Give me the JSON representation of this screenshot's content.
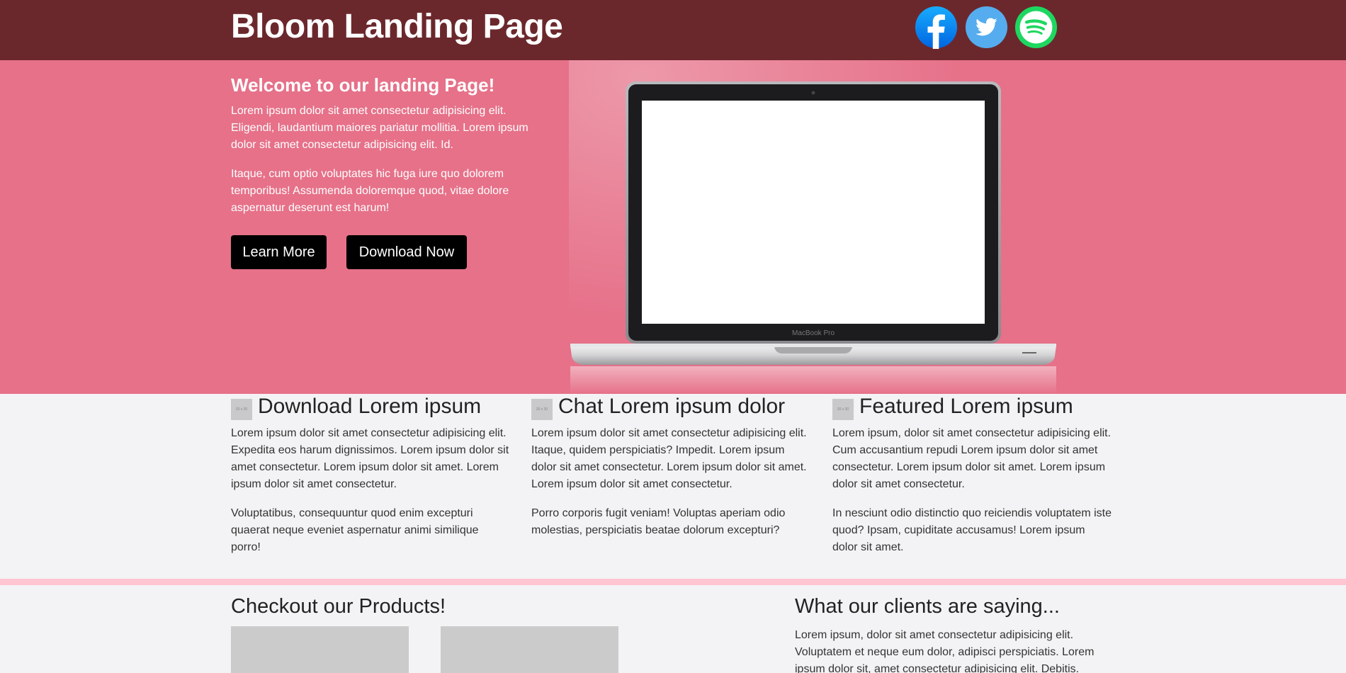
{
  "header": {
    "title": "Bloom Landing Page",
    "social": [
      {
        "icon": "facebook-icon",
        "color": "#1877f2"
      },
      {
        "icon": "twitter-icon",
        "color": "#55acee"
      },
      {
        "icon": "spotify-icon",
        "color": "#1ed760"
      }
    ]
  },
  "hero": {
    "title": "Welcome to our landing Page!",
    "paragraphs": [
      "Lorem ipsum dolor sit amet consectetur adipisicing elit. Eligendi, laudantium maiores pariatur mollitia. Lorem ipsum dolor sit amet consectetur adipisicing elit. Id.",
      "Itaque, cum optio voluptates hic fuga iure quo dolorem temporibus! Assumenda doloremque quod, vitae dolore aspernatur deserunt est harum!"
    ],
    "learn_more_label": "Learn More",
    "download_label": "Download Now",
    "laptop_brand": "MacBook Pro"
  },
  "features": [
    {
      "icon_text": "30 x 30",
      "title": "Download Lorem ipsum",
      "paragraphs": [
        "Lorem ipsum dolor sit amet consectetur adipisicing elit. Expedita eos harum dignissimos. Lorem ipsum dolor sit amet consectetur. Lorem ipsum dolor sit amet. Lorem ipsum dolor sit amet consectetur.",
        "Voluptatibus, consequuntur quod enim excepturi quaerat neque eveniet aspernatur animi similique porro!"
      ]
    },
    {
      "icon_text": "30 x 30",
      "title": "Chat Lorem ipsum dolor",
      "paragraphs": [
        "Lorem ipsum dolor sit amet consectetur adipisicing elit. Itaque, quidem perspiciatis? Impedit. Lorem ipsum dolor sit amet consectetur. Lorem ipsum dolor sit amet. Lorem ipsum dolor sit amet consectetur.",
        "Porro corporis fugit veniam! Voluptas aperiam odio molestias, perspiciatis beatae dolorum excepturi?"
      ]
    },
    {
      "icon_text": "30 x 30",
      "title": "Featured Lorem ipsum",
      "paragraphs": [
        "Lorem ipsum, dolor sit amet consectetur adipisicing elit. Cum accusantium repudi Lorem ipsum dolor sit amet consectetur. Lorem ipsum dolor sit amet. Lorem ipsum dolor sit amet consectetur.",
        "In nesciunt odio distinctio quo reiciendis voluptatem iste quod? Ipsam, cupiditate accusamus! Lorem ipsum dolor sit amet."
      ]
    }
  ],
  "products": {
    "title": "Checkout our Products!"
  },
  "clients": {
    "title": "What our clients are saying...",
    "text": "Lorem ipsum, dolor sit amet consectetur adipisicing elit. Voluptatem et neque eum dolor, adipisci perspiciatis. Lorem ipsum dolor sit, amet consectetur adipisicing elit. Debitis."
  },
  "colors": {
    "header_bg": "#6b282c",
    "hero_bg": "#e67189",
    "page_bg": "#f3f3f5",
    "divider": "#ffc6d1",
    "button_bg": "#000000"
  }
}
